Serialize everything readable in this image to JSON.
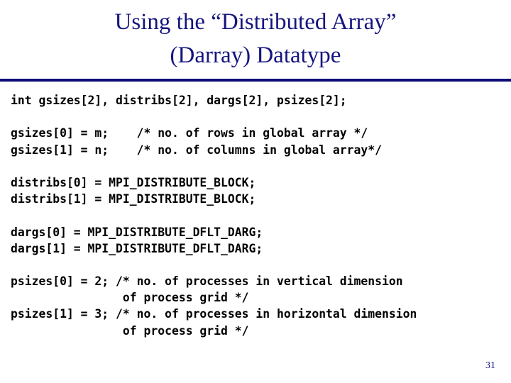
{
  "slide": {
    "title": {
      "line1": "Using the “Distributed Array”",
      "line2": "(Darray) Datatype"
    },
    "accent_color": "#15157e",
    "rule_color": "#0a0a78",
    "background_color": "#ffffff",
    "code_color": "#000000",
    "page_number": "31",
    "code_lines": [
      "int gsizes[2], distribs[2], dargs[2], psizes[2];",
      "",
      "gsizes[0] = m;    /* no. of rows in global array */",
      "gsizes[1] = n;    /* no. of columns in global array*/",
      "",
      "distribs[0] = MPI_DISTRIBUTE_BLOCK;",
      "distribs[1] = MPI_DISTRIBUTE_BLOCK;",
      "",
      "dargs[0] = MPI_DISTRIBUTE_DFLT_DARG;",
      "dargs[1] = MPI_DISTRIBUTE_DFLT_DARG;",
      "",
      "psizes[0] = 2; /* no. of processes in vertical dimension",
      "                of process grid */",
      "psizes[1] = 3; /* no. of processes in horizontal dimension",
      "                of process grid */"
    ]
  }
}
